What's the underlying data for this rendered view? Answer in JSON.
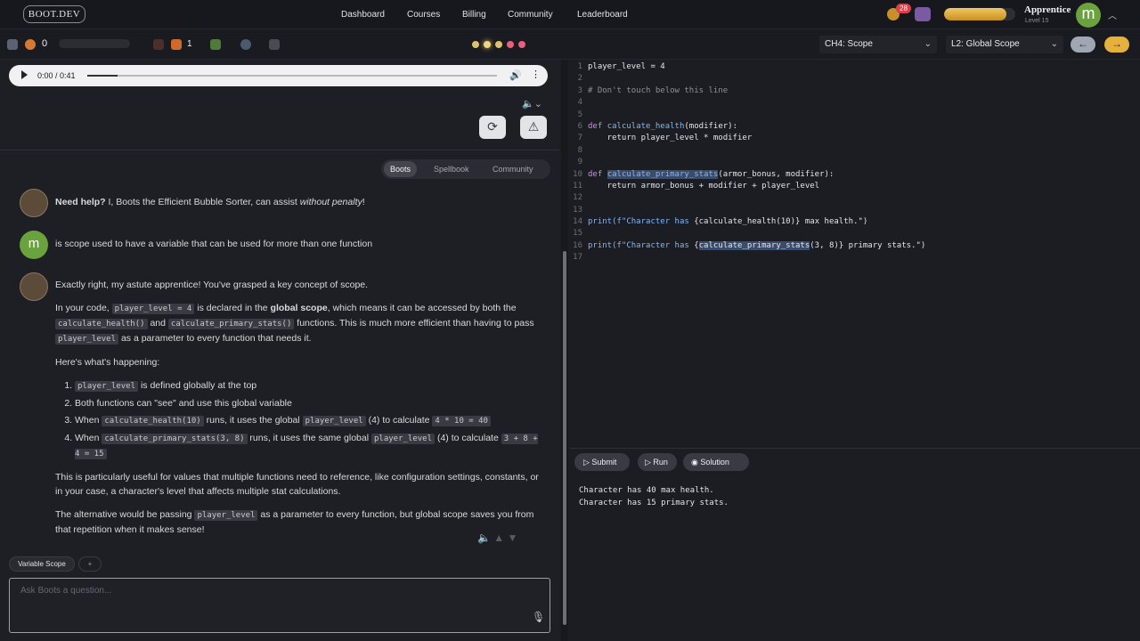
{
  "topbar": {
    "logo": "BOOT.DEV",
    "nav": [
      "Dashboard",
      "Courses",
      "Billing",
      "Community",
      "Leaderboard"
    ],
    "notifications": "28",
    "rank": "Apprentice",
    "level": "Level 15",
    "avatar_initial": "m",
    "xp_fraction": 0.88
  },
  "statusbar": {
    "hearts": "0",
    "flames": "1",
    "chapter": "CH4: Scope",
    "lesson": "L2: Global Scope"
  },
  "audio": {
    "time": "0:00 / 0:41"
  },
  "tabs": [
    "Boots",
    "Spellbook",
    "Community"
  ],
  "chat": {
    "intro_bold": "Need help?",
    "intro_text": " I, Boots the Efficient Bubble Sorter, can assist ",
    "intro_em": "without penalty",
    "intro_end": "!",
    "user_msg": "is scope used to have a variable that can be used for more than one function",
    "reply_1": "Exactly right, my astute apprentice! You've grasped a key concept of scope.",
    "p2_a": "In your code, ",
    "p2_code1": "player_level = 4",
    "p2_b": " is declared in the ",
    "p2_bold": "global scope",
    "p2_c": ", which means it can be accessed by both the ",
    "p2_code2": "calculate_health()",
    "p2_d": " and ",
    "p2_code3": "calculate_primary_stats()",
    "p2_e": " functions. This is much more efficient than having to pass ",
    "p2_code4": "player_level",
    "p2_f": " as a parameter to every function that needs it.",
    "p3": "Here's what's happening:",
    "li1_code": "player_level",
    "li1_text": " is defined globally at the top",
    "li2": "Both functions can \"see\" and use this global variable",
    "li3_a": "When ",
    "li3_code1": "calculate_health(10)",
    "li3_b": " runs, it uses the global ",
    "li3_code2": "player_level",
    "li3_c": " (4) to calculate ",
    "li3_code3": "4 * 10 = 40",
    "li4_a": "When ",
    "li4_code1": "calculate_primary_stats(3, 8)",
    "li4_b": " runs, it uses the same global ",
    "li4_code2": "player_level",
    "li4_c": " (4) to calculate ",
    "li4_code3": "3 + 8 + 4 = 15",
    "p4": "This is particularly useful for values that multiple functions need to reference, like configuration settings, constants, or in your case, a character's level that affects multiple stat calculations.",
    "p5_a": "The alternative would be passing ",
    "p5_code": "player_level",
    "p5_b": " as a parameter to every function, but global scope saves you from that repetition when it makes sense!"
  },
  "chip": "Variable Scope",
  "input_placeholder": "Ask Boots a question...",
  "buttons": {
    "submit": "Submit",
    "run": "Run",
    "solution": "Solution"
  },
  "output": [
    "Character has 40 max health.",
    "Character has 15 primary stats."
  ],
  "code": {
    "l1": "player_level = 4",
    "l3": "# Don't touch below this line",
    "l6_kw": "def ",
    "l6_fn": "calculate_health",
    "l6_rest": "(modifier):",
    "l7": "    return player_level * modifier",
    "l10_kw": "def ",
    "l10_fn": "calculate_primary_stats",
    "l10_rest": "(armor_bonus, modifier):",
    "l11": "    return armor_bonus + modifier + player_level",
    "l14_a": "print(f\"Character has ",
    "l14_b": "{calculate_health(10)}",
    "l14_c": " max health.\")",
    "l16_a": "print(f\"Character has ",
    "l16_b": "{",
    "l16_c": "calculate_primary_stats",
    "l16_d": "(3, 8)}",
    "l16_e": " primary stats.\")"
  }
}
